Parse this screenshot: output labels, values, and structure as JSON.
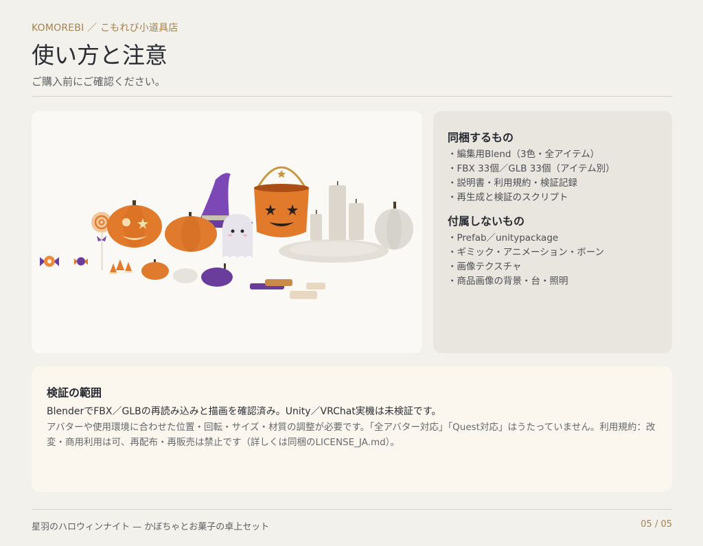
{
  "header": {
    "brand": "KOMOREBI ／ こもれび小道具店",
    "title": "使い方と注意",
    "subtitle": "ご購入前にご確認ください。"
  },
  "included": {
    "heading": "同梱するもの",
    "items": [
      "・編集用Blend（3色・全アイテム）",
      "・FBX 33個／GLB 33個（アイテム別）",
      "・説明書・利用規約・検証記録",
      "・再生成と検証のスクリプト"
    ]
  },
  "excluded": {
    "heading": "付属しないもの",
    "items": [
      "・Prefab／unitypackage",
      "・ギミック・アニメーション・ボーン",
      "・画像テクスチャ",
      "・商品画像の背景・台・照明"
    ]
  },
  "verification": {
    "heading": "検証の範囲",
    "main": "BlenderでFBX／GLBの再読み込みと描画を確認済み。Unity／VRChat実機は未検証です。",
    "note": "アバターや使用環境に合わせた位置・回転・サイズ・材質の調整が必要です。「全アバター対応」「Quest対応」はうたっていません。利用規約：改変・商用利用は可、再配布・再販売は禁止です（詳しくは同梱のLICENSE_JA.md）。"
  },
  "footer": {
    "product": "星羽のハロウィンナイト — かぼちゃとお菓子の卓上セット",
    "page": "05 / 05"
  },
  "colors": {
    "accent": "#a4814d",
    "pumpkin": "#e07a2c",
    "purple": "#6a3c9c",
    "candle": "#dcd6cc"
  }
}
